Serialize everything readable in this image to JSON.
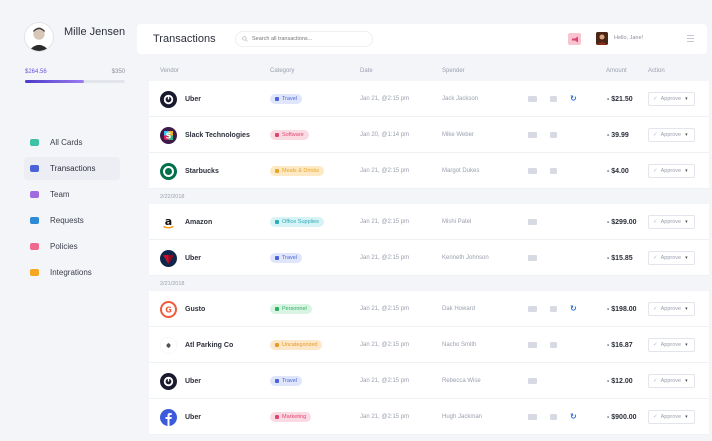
{
  "profile": {
    "name": "Mille Jensen"
  },
  "budget": {
    "spent": "$264.56",
    "total": "$350",
    "spent_fraction": 0.756
  },
  "nav": [
    {
      "label": "All Cards",
      "icon": "cards-icon",
      "color": "#3fc1a5"
    },
    {
      "label": "Transactions",
      "icon": "transactions-icon",
      "color": "#4a63d8"
    },
    {
      "label": "Team",
      "icon": "team-icon",
      "color": "#a06be0"
    },
    {
      "label": "Requests",
      "icon": "requests-icon",
      "color": "#2d8bd6"
    },
    {
      "label": "Policies",
      "icon": "policies-icon",
      "color": "#f06a8e"
    },
    {
      "label": "Integrations",
      "icon": "integrations-icon",
      "color": "#f5a623"
    }
  ],
  "active_nav": "Transactions",
  "topbar": {
    "title": "Transactions",
    "search_placeholder": "Search all transactions...",
    "greeting": "Hello, Jane!"
  },
  "columns": {
    "vendor": "Vendor",
    "category": "Category",
    "date": "Date",
    "spender": "Spender",
    "amount": "Amount",
    "action": "Action"
  },
  "groups": [
    {
      "label": "",
      "rows": [
        {
          "vendor": "Uber",
          "logo": "uber",
          "category": "Travel",
          "cat": "travel",
          "date": "Jan 21, @2:15 pm",
          "spender": "Jack Jackson",
          "amount": "- $21.50",
          "receipt": true,
          "camera": true,
          "sync": true
        },
        {
          "vendor": "Slack Technologies",
          "logo": "slack",
          "category": "Software",
          "cat": "software",
          "date": "Jan 20, @1:14 pm",
          "spender": "Mike Weber",
          "amount": "- 39.99",
          "receipt": true,
          "camera": true,
          "sync": false
        },
        {
          "vendor": "Starbucks",
          "logo": "starbucks",
          "category": "Meals & Drinks",
          "cat": "meals",
          "date": "Jan 21, @2:15 pm",
          "spender": "Margot Dukes",
          "amount": "- $4.00",
          "receipt": true,
          "camera": true,
          "sync": false
        }
      ]
    },
    {
      "label": "2/22/2018",
      "rows": [
        {
          "vendor": "Amazon",
          "logo": "amazon",
          "category": "Office Supplies",
          "cat": "office",
          "date": "Jan 21, @2:15 pm",
          "spender": "Mishi Patel",
          "amount": "- $299.00",
          "receipt": true,
          "camera": false,
          "sync": false
        },
        {
          "vendor": "Uber",
          "logo": "delta",
          "category": "Travel",
          "cat": "travel",
          "date": "Jan 21, @2:15 pm",
          "spender": "Kenneth Johnson",
          "amount": "- $15.85",
          "receipt": true,
          "camera": false,
          "sync": false
        }
      ]
    },
    {
      "label": "2/21/2018",
      "rows": [
        {
          "vendor": "Gusto",
          "logo": "gusto",
          "category": "Personnel",
          "cat": "personnel",
          "date": "Jan 21, @2:15 pm",
          "spender": "Dak Howard",
          "amount": "- $198.00",
          "receipt": true,
          "camera": true,
          "sync": true
        },
        {
          "vendor": "Atl Parking Co",
          "logo": "parking",
          "category": "Uncategorized",
          "cat": "uncat",
          "date": "Jan 21, @2:15 pm",
          "spender": "Nacho Smith",
          "amount": "- $16.87",
          "receipt": true,
          "camera": true,
          "sync": false
        },
        {
          "vendor": "Uber",
          "logo": "uber",
          "category": "Travel",
          "cat": "travel",
          "date": "Jan 21, @2:15 pm",
          "spender": "Rebecca Wise",
          "amount": "- $12.00",
          "receipt": true,
          "camera": false,
          "sync": false
        },
        {
          "vendor": "Uber",
          "logo": "facebook",
          "category": "Marketing",
          "cat": "marketing",
          "date": "Jan 21, @2:15 pm",
          "spender": "Hugh Jackman",
          "amount": "- $900.00",
          "receipt": true,
          "camera": true,
          "sync": true
        }
      ]
    }
  ],
  "approve_label": "Approve",
  "category_colors": {
    "travel": {
      "bg": "#dfe6fb",
      "fg": "#4a63d8"
    },
    "software": {
      "bg": "#fbdbe3",
      "fg": "#e0456f"
    },
    "meals": {
      "bg": "#fde9c4",
      "fg": "#e8a52a"
    },
    "office": {
      "bg": "#d8f3f6",
      "fg": "#2eaab8"
    },
    "personnel": {
      "bg": "#d9f4e2",
      "fg": "#2fae62"
    },
    "uncat": {
      "bg": "#fde7c9",
      "fg": "#e89b2a"
    },
    "marketing": {
      "bg": "#fbdbe3",
      "fg": "#e0456f"
    }
  }
}
